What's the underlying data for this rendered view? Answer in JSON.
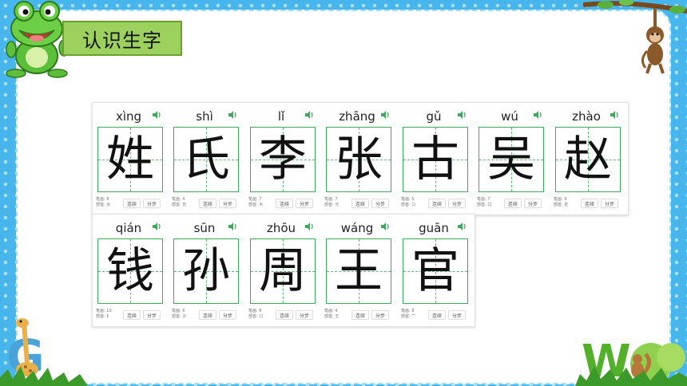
{
  "header": {
    "title": "认识生字"
  },
  "characters_row1": [
    {
      "pinyin": "xìng",
      "hanzi": "姓",
      "strokes": "笔画: 8",
      "radical": "部首: 女"
    },
    {
      "pinyin": "shì",
      "hanzi": "氏",
      "strokes": "笔画: 4",
      "radical": "部首: 氏"
    },
    {
      "pinyin": "lǐ",
      "hanzi": "李",
      "strokes": "笔画: 7",
      "radical": "部首: 木"
    },
    {
      "pinyin": "zhāng",
      "hanzi": "张",
      "strokes": "笔画: 7",
      "radical": "部首: 弓"
    },
    {
      "pinyin": "gǔ",
      "hanzi": "古",
      "strokes": "笔画: 5",
      "radical": "部首: 口"
    },
    {
      "pinyin": "wú",
      "hanzi": "吴",
      "strokes": "笔画: 7",
      "radical": "部首: 口"
    },
    {
      "pinyin": "zhào",
      "hanzi": "赵",
      "strokes": "笔画: 9",
      "radical": "部首: 走"
    }
  ],
  "characters_row2": [
    {
      "pinyin": "qián",
      "hanzi": "钱",
      "strokes": "笔画: 10",
      "radical": "部首: 钅"
    },
    {
      "pinyin": "sūn",
      "hanzi": "孙",
      "strokes": "笔画: 6",
      "radical": "部首: 子"
    },
    {
      "pinyin": "zhōu",
      "hanzi": "周",
      "strokes": "笔画: 8",
      "radical": "部首: 口"
    },
    {
      "pinyin": "wáng",
      "hanzi": "王",
      "strokes": "笔画: 4",
      "radical": "部首: 王"
    },
    {
      "pinyin": "guān",
      "hanzi": "官",
      "strokes": "笔画: 8",
      "radical": "部首: 宀"
    }
  ],
  "buttons": {
    "continuous": "连续",
    "step": "分步"
  },
  "icons": {
    "speaker": "speaker-icon"
  },
  "colors": {
    "grid": "#3fa85c",
    "title_bg": "#9bd15c",
    "background": "#47b6ec"
  },
  "decorations": {
    "w_letter": "W",
    "g_letter": "G"
  }
}
